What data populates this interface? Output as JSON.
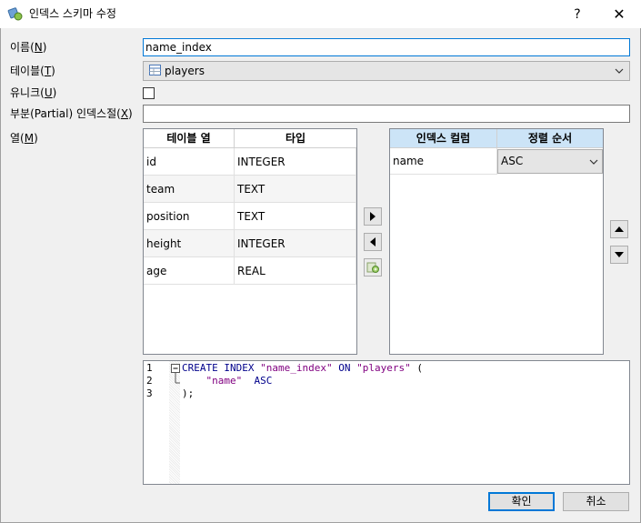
{
  "window": {
    "title": "인덱스 스키마 수정",
    "help_label": "?",
    "close_label": "✕"
  },
  "form": {
    "name_label": "이름(",
    "name_key": "N",
    "name_value": "name_index",
    "table_label": "테이블(",
    "table_key": "T",
    "table_value": "players",
    "unique_label": "유니크(",
    "unique_key": "U",
    "unique_checked": false,
    "partial_label": "부분(Partial) 인덱스절(",
    "partial_key": "X",
    "partial_value": "",
    "columns_label": "열(",
    "columns_key": "M",
    "close_paren": ")"
  },
  "table_columns": {
    "headers": [
      "테이블 열",
      "타입"
    ],
    "rows": [
      {
        "name": "id",
        "type": "INTEGER"
      },
      {
        "name": "team",
        "type": "TEXT"
      },
      {
        "name": "position",
        "type": "TEXT"
      },
      {
        "name": "height",
        "type": "INTEGER"
      },
      {
        "name": "age",
        "type": "REAL"
      }
    ]
  },
  "index_columns": {
    "headers": [
      "인덱스 컬럼",
      "정렬 순서"
    ],
    "rows": [
      {
        "name": "name",
        "order": "ASC"
      }
    ]
  },
  "sql": {
    "line_numbers": [
      "1",
      "2",
      "3"
    ],
    "kw_create": "CREATE",
    "kw_index": "INDEX",
    "index_name": "\"name_index\"",
    "kw_on": "ON",
    "table_name": "\"players\"",
    "open_paren": "(",
    "col_name": "\"name\"",
    "col_order": "ASC",
    "close": ");"
  },
  "buttons": {
    "ok": "확인",
    "cancel": "취소"
  },
  "colors": {
    "accent": "#0078d7",
    "index_header": "#cce4f7"
  }
}
